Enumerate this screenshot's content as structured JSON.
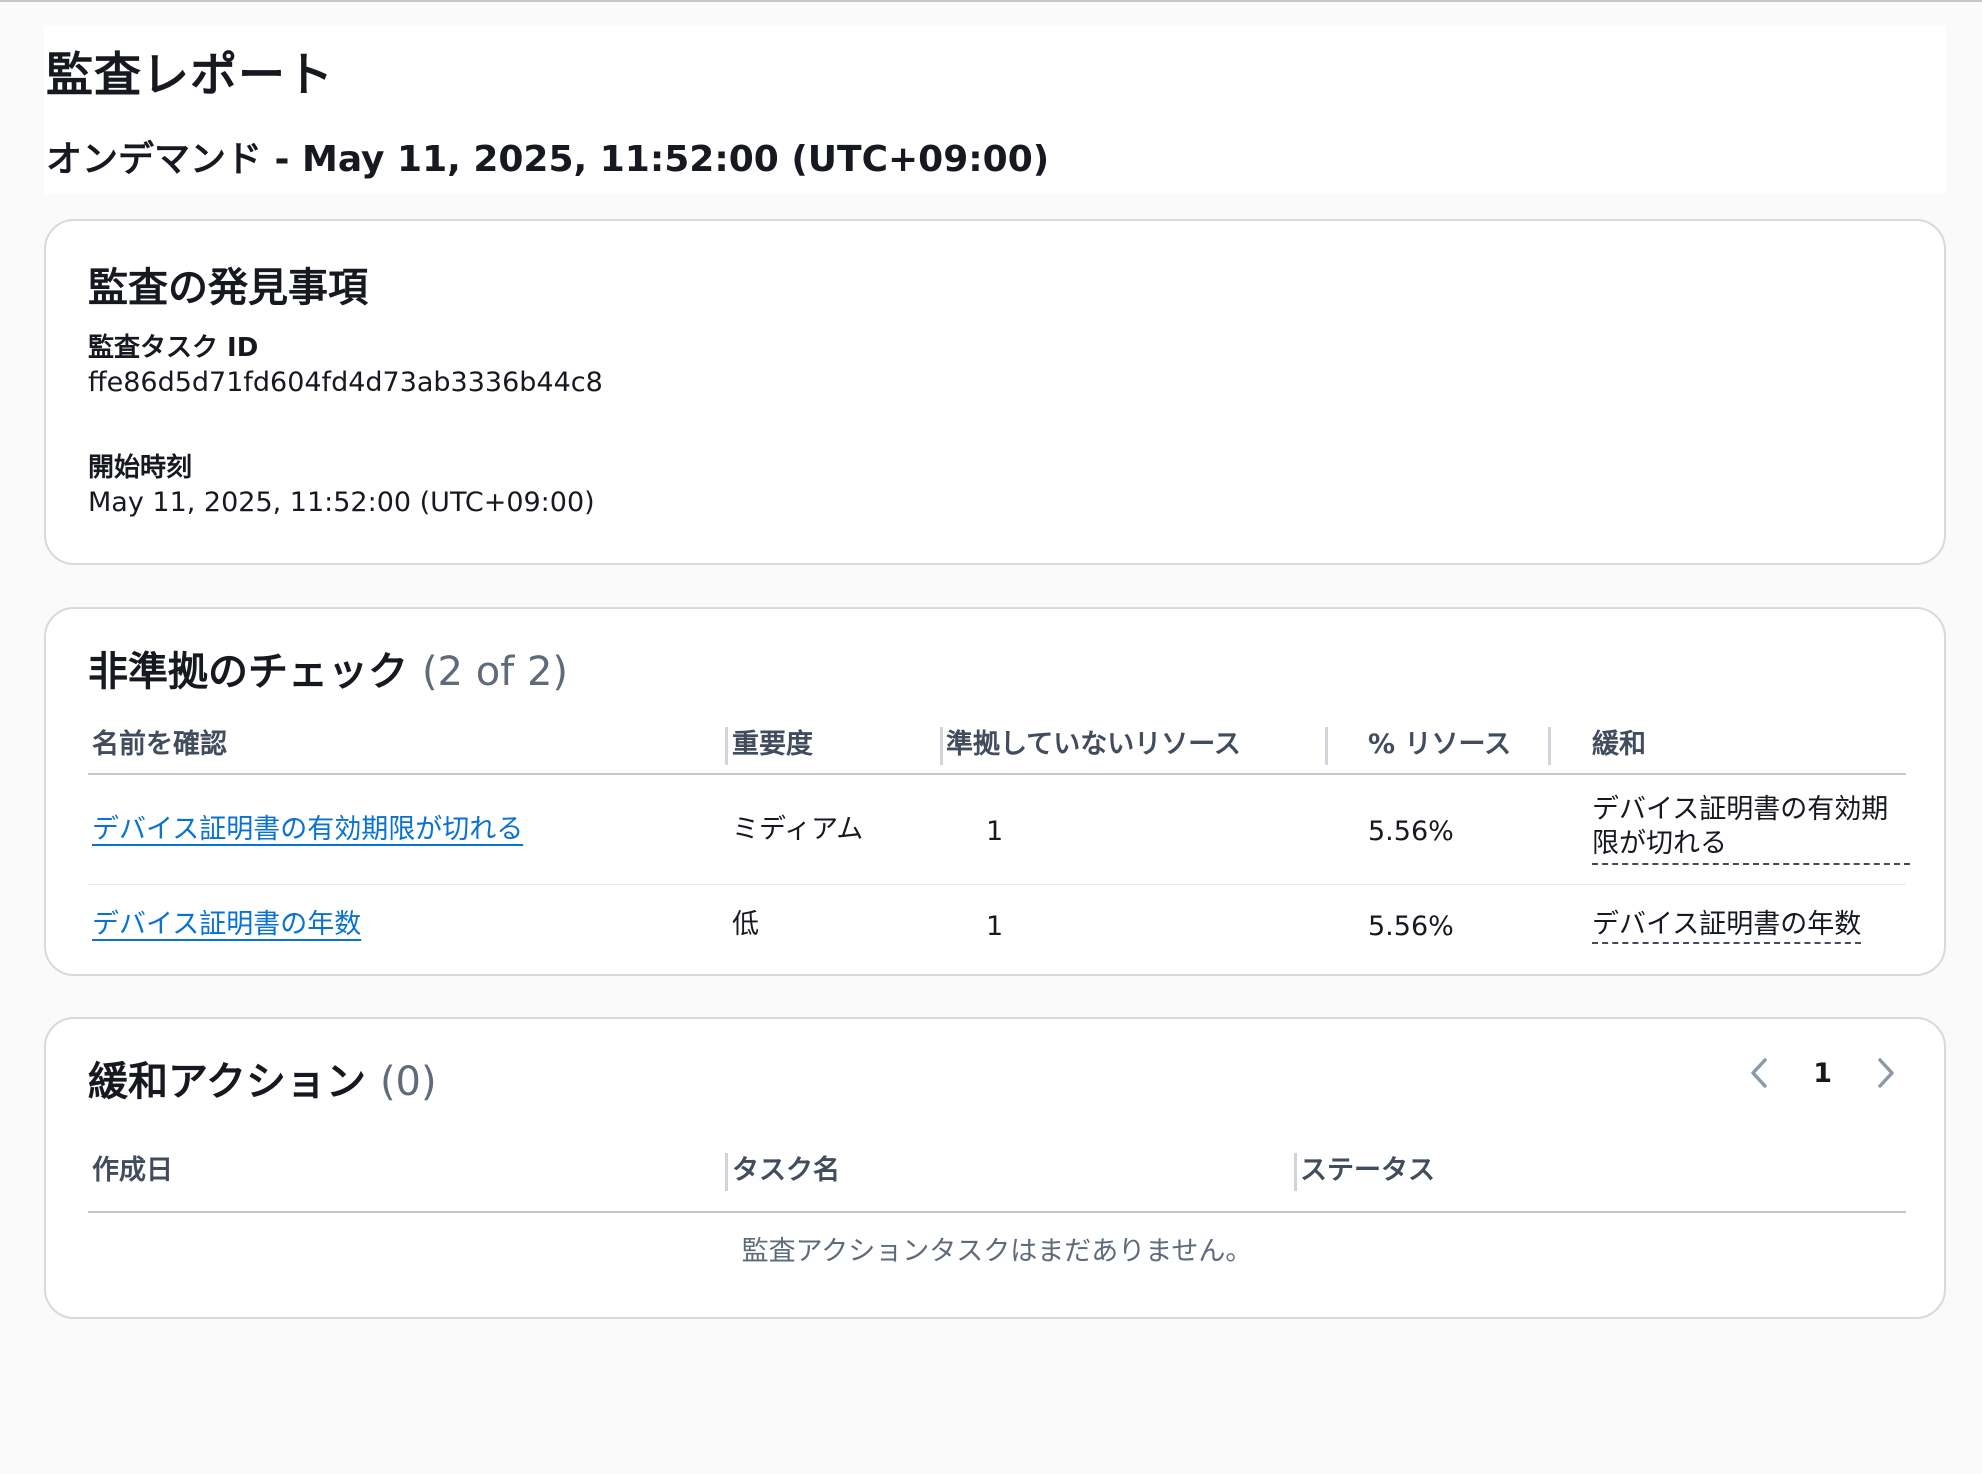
{
  "header": {
    "title": "監査レポート",
    "subtitle": "オンデマンド - May 11, 2025, 11:52:00 (UTC+09:00)"
  },
  "findings": {
    "title": "監査の発見事項",
    "task_id_label": "監査タスク ID",
    "task_id_value": "ffe86d5d71fd604fd4d73ab3336b44c8",
    "start_time_label": "開始時刻",
    "start_time_value": "May 11, 2025, 11:52:00 (UTC+09:00)"
  },
  "noncompliant": {
    "title": "非準拠のチェック",
    "count": "(2 of 2)",
    "columns": [
      "名前を確認",
      "重要度",
      "準拠していないリソース",
      "% リソース",
      "緩和"
    ],
    "rows": [
      {
        "name": "デバイス証明書の有効期限が切れる",
        "severity": "ミディアム",
        "noncompliant_resources": "1",
        "percent": "5.56%",
        "mitigation_line1": "デバイス証明書の有効期",
        "mitigation_line2": "限が切れる"
      },
      {
        "name": "デバイス証明書の年数",
        "severity": "低",
        "noncompliant_resources": "1",
        "percent": "5.56%",
        "mitigation_line1": "デバイス証明書の年数"
      }
    ]
  },
  "mitigation": {
    "title": "緩和アクション",
    "count": "(0)",
    "page": "1",
    "columns": [
      "作成日",
      "タスク名",
      "ステータス"
    ],
    "empty_message": "監査アクションタスクはまだありません。"
  },
  "icons": {
    "prev": "chevron-left-icon",
    "next": "chevron-right-icon"
  },
  "colors": {
    "link": "#0972d3",
    "border": "#d5dbdb",
    "heading_muted": "#5f6b7a"
  }
}
